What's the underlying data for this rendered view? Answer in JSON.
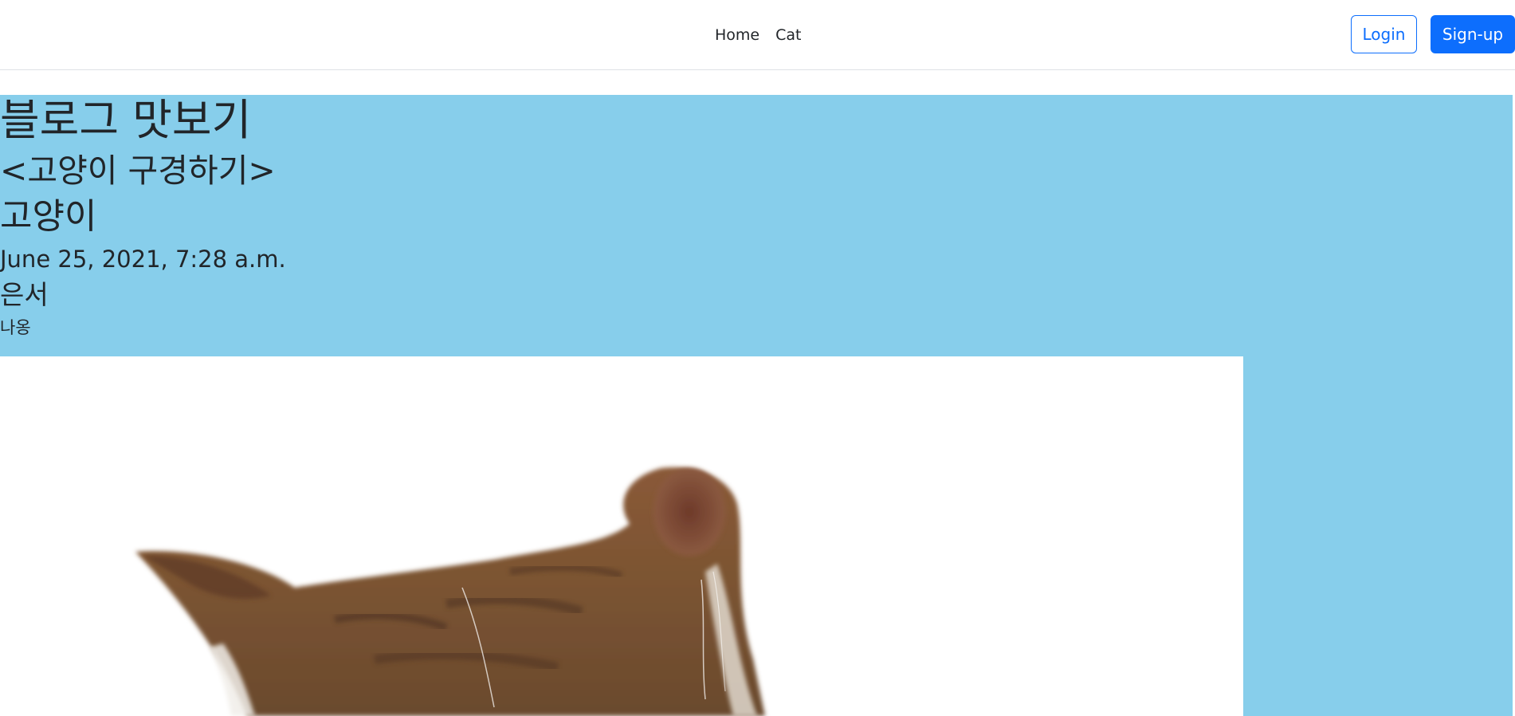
{
  "nav": {
    "links": [
      "Home",
      "Cat"
    ],
    "login_label": "Login",
    "signup_label": "Sign-up"
  },
  "post": {
    "title": "블로그 맛보기",
    "subtitle": "<고양이 구경하기>",
    "category": "고양이",
    "date": "June 25, 2021, 7:28 a.m.",
    "author": "은서",
    "body": "나옹",
    "image_subject": "cat-photo"
  },
  "colors": {
    "content_background": "#87ceeb",
    "primary": "#0d6efd",
    "navbar_background": "#ffffff"
  }
}
